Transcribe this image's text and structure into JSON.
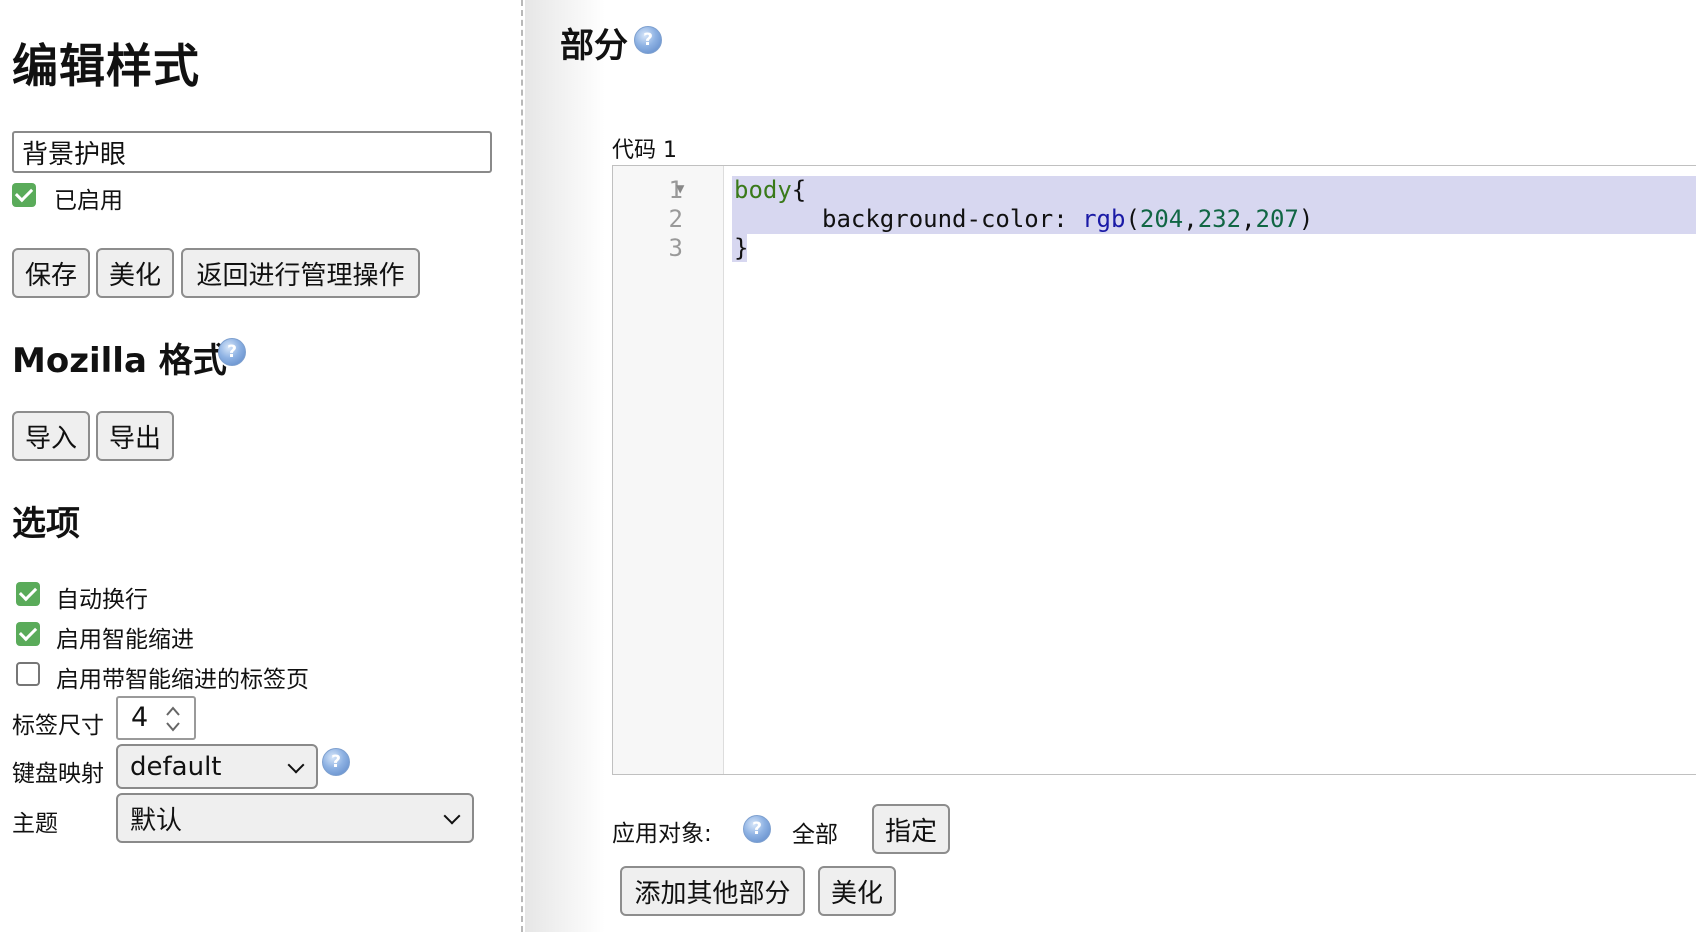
{
  "sidebar": {
    "title": "编辑样式",
    "style_name": "背景护眼",
    "enabled_label": "已启用",
    "buttons": {
      "save": "保存",
      "beautify": "美化",
      "back": "返回进行管理操作"
    },
    "mozilla_heading": "Mozilla 格式",
    "import_label": "导入",
    "export_label": "导出",
    "options_heading": "选项",
    "options": {
      "wrap_label": "自动换行",
      "smart_indent_label": "启用智能缩进",
      "tab_smart_indent_label": "启用带智能缩进的标签页",
      "tab_size_label": "标签尺寸",
      "tab_size_value": "4",
      "keymap_label": "键盘映射",
      "keymap_value": "default",
      "theme_label": "主题",
      "theme_value": "默认"
    },
    "checks": {
      "enabled": true,
      "wrap": true,
      "smart_indent": true,
      "tab_smart_indent": false
    }
  },
  "main": {
    "title": "部分",
    "code_label": "代码 1",
    "line_numbers": [
      "1",
      "2",
      "3"
    ],
    "code": {
      "l1_selector": "body",
      "l1_brace": "{",
      "l2_prop": "background-color: ",
      "l2_fn": "rgb",
      "l2_open": "(",
      "l2_n1": "204",
      "l2_n2": "232",
      "l2_n3": "207",
      "l2_comma": ",",
      "l2_close": ")",
      "l3_brace": "}"
    },
    "apply_label": "应用对象:",
    "apply_all": "全部",
    "specify_button": "指定",
    "add_section_button": "添加其他部分",
    "beautify_button": "美化"
  },
  "icons": {
    "help": "help-circle-icon",
    "fold": "fold-arrow-icon"
  },
  "colors": {
    "check_green": "#5aab5a",
    "selection": "#d7d7f0",
    "help_blue": "#5b86c6"
  }
}
